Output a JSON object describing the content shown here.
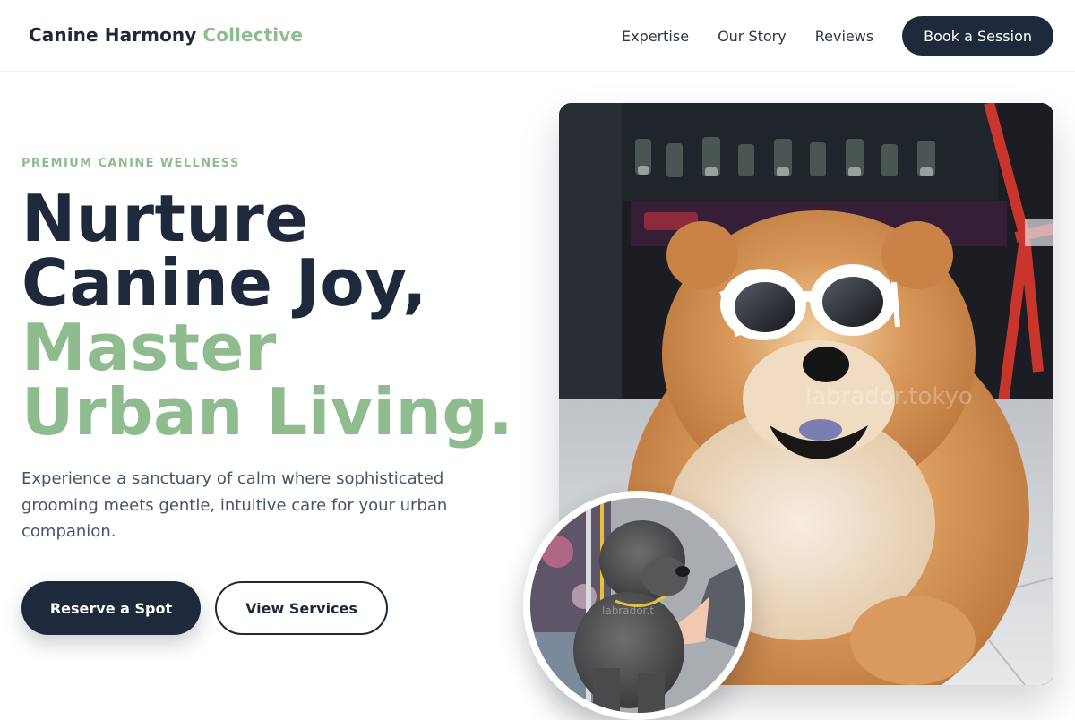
{
  "header": {
    "brand_primary": "Canine Harmony",
    "brand_accent": "Collective",
    "nav": [
      {
        "label": "Expertise"
      },
      {
        "label": "Our Story"
      },
      {
        "label": "Reviews"
      }
    ],
    "cta_label": "Book a Session"
  },
  "hero": {
    "eyebrow": "PREMIUM CANINE WELLNESS",
    "headline_dark": [
      "Nurture",
      "Canine Joy,"
    ],
    "headline_green": [
      "Master",
      "Urban Living."
    ],
    "description": "Experience a sanctuary of calm where sophisticated grooming meets gentle, intuitive care for your urban companion.",
    "primary_button": "Reserve a Spot",
    "secondary_button": "View Services",
    "main_photo_watermark": "labrador.tokyo",
    "inset_photo_watermark": "labrador.t"
  },
  "colors": {
    "navy": "#1e293b",
    "sage": "#8fbc8f",
    "body_text": "#475569",
    "background": "#ffffff"
  }
}
